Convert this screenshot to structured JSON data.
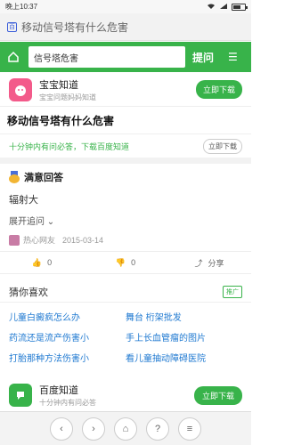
{
  "status": {
    "time": "晚上10:37",
    "signal": "4G"
  },
  "urlbar": {
    "icon": "baidu-icon",
    "text": "移动信号塔有什么危害"
  },
  "searchbar": {
    "query": "信号塔危害",
    "ask_label": "提问",
    "menu_label": "☰"
  },
  "app_promo": {
    "title": "宝宝知道",
    "subtitle": "宝宝问题妈妈知道",
    "button": "立即下载"
  },
  "question": {
    "title": "移动信号塔有什么危害"
  },
  "promo": {
    "text": "十分钟内有问必答，下载百度知道",
    "button": "立即下载"
  },
  "answer": {
    "heading": "满意回答",
    "body": "辐射大",
    "expand": "展开追问",
    "author": "热心网友",
    "date": "2015-03-14"
  },
  "actions": {
    "like_count": "0",
    "dislike_count": "0",
    "share_label": "分享"
  },
  "guess": {
    "title": "猜你喜欢",
    "tag": "推广",
    "items": [
      "儿童白癜疯怎么办",
      "舞台 桁架批发",
      "药流还是流产伤害小",
      "手上长血管瘤的图片",
      "打胎那种方法伤害小",
      "看儿童抽动障碍医院"
    ]
  },
  "bottom_app": {
    "title": "百度知道",
    "subtitle": "十分钟内有问必答",
    "button": "立即下载"
  },
  "nav": {
    "back": "‹",
    "forward": "›",
    "home": "⌂",
    "help": "?",
    "tabs": "≡"
  }
}
